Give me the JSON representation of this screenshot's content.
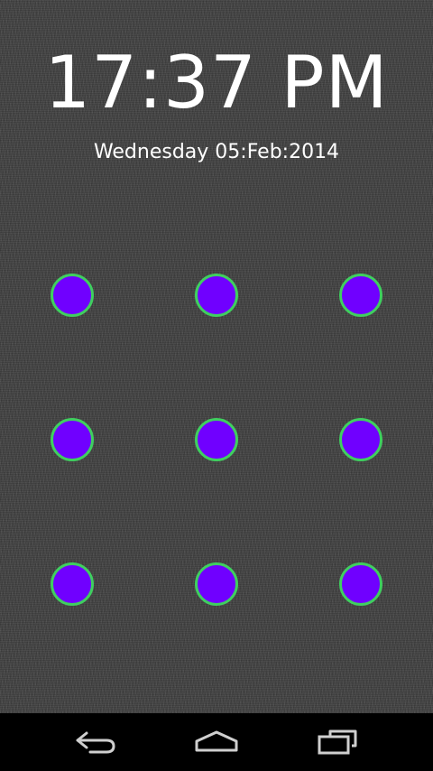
{
  "lock_screen": {
    "time": "17:37 PM",
    "date": "Wednesday 05:Feb:2014"
  },
  "pattern": {
    "rows": 3,
    "cols": 3,
    "dot_fill": "#7000ff",
    "dot_ring": "#3fcf5f"
  },
  "nav_bar": {
    "back_icon": "back-icon",
    "home_icon": "home-icon",
    "recents_icon": "recent-apps-icon",
    "icon_color": "#cfcfcf"
  },
  "colors": {
    "background": "#454545",
    "text": "#ffffff",
    "nav_background": "#000000"
  }
}
